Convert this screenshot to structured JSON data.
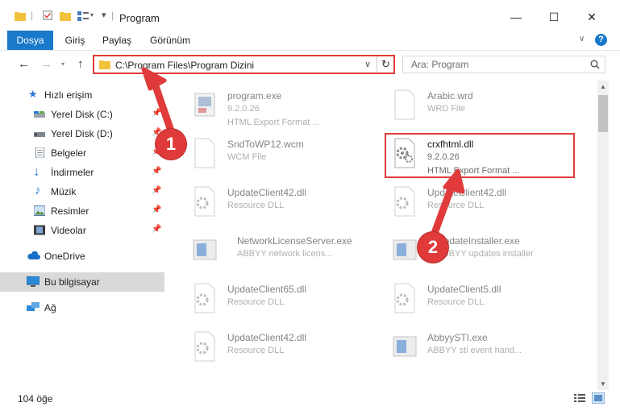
{
  "window": {
    "title": "Program"
  },
  "ribbon": {
    "tabs": [
      "Dosya",
      "Giriş",
      "Paylaş",
      "Görünüm"
    ]
  },
  "address": {
    "path": "C:\\Program Files\\Program Dizini",
    "search_placeholder": "Ara: Program"
  },
  "sidebar": {
    "items": [
      {
        "label": "Hızlı erişim",
        "icon": "star-icon",
        "pinned": false
      },
      {
        "label": "Yerel Disk (C:)",
        "icon": "drive-icon",
        "pinned": true
      },
      {
        "label": "Yerel Disk (D:)",
        "icon": "drive-icon",
        "pinned": true
      },
      {
        "label": "Belgeler",
        "icon": "documents-icon",
        "pinned": true
      },
      {
        "label": "İndirmeler",
        "icon": "download-icon",
        "pinned": true
      },
      {
        "label": "Müzik",
        "icon": "music-icon",
        "pinned": true
      },
      {
        "label": "Resimler",
        "icon": "pictures-icon",
        "pinned": true
      },
      {
        "label": "Videolar",
        "icon": "video-icon",
        "pinned": true
      },
      {
        "label": "OneDrive",
        "icon": "cloud-icon",
        "pinned": false
      },
      {
        "label": "Bu bilgisayar",
        "icon": "computer-icon",
        "pinned": false
      },
      {
        "label": "Ağ",
        "icon": "network-icon",
        "pinned": false
      }
    ]
  },
  "files": [
    {
      "name": "program.exe",
      "line2": "9.2.0.26",
      "line3": "HTML Export Format ...",
      "icon": "exe-icon"
    },
    {
      "name": "Arabic.wrd",
      "line2": "WRD File",
      "line3": "",
      "icon": "file-icon"
    },
    {
      "name": "SndToWP12.wcm",
      "line2": "WCM File",
      "line3": "",
      "icon": "file-icon"
    },
    {
      "name": "crxfhtml.dll",
      "line2": "9.2.0.26",
      "line3": "HTML Export Format ...",
      "icon": "dll-gear-icon"
    },
    {
      "name": "UpdateClient42.dll",
      "line2": "Resource DLL",
      "line3": "",
      "icon": "dll-gear-icon"
    },
    {
      "name": "UpdateClient42.dll",
      "line2": "Resource DLL",
      "line3": "",
      "icon": "dll-gear-icon"
    },
    {
      "name": "NetworkLicenseServer.exe",
      "line2": "ABBYY network licens...",
      "line3": "",
      "icon": "app-icon"
    },
    {
      "name": "UpdateInstaller.exe",
      "line2": "ABBYY updates installer",
      "line3": "",
      "icon": "app-icon"
    },
    {
      "name": "UpdateClient65.dll",
      "line2": "Resource DLL",
      "line3": "",
      "icon": "dll-gear-icon"
    },
    {
      "name": "UpdateClient5.dll",
      "line2": "Resource DLL",
      "line3": "",
      "icon": "dll-gear-icon"
    },
    {
      "name": "UpdateClient42.dll",
      "line2": "Resource DLL",
      "line3": "",
      "icon": "dll-gear-icon"
    },
    {
      "name": "AbbyySTI.exe",
      "line2": "ABBYY sti event hand...",
      "line3": "",
      "icon": "app-icon"
    }
  ],
  "annotations": {
    "marker1": "1",
    "marker2": "2",
    "color": "#e03a3a"
  },
  "status": {
    "item_count": "104 öğe"
  }
}
